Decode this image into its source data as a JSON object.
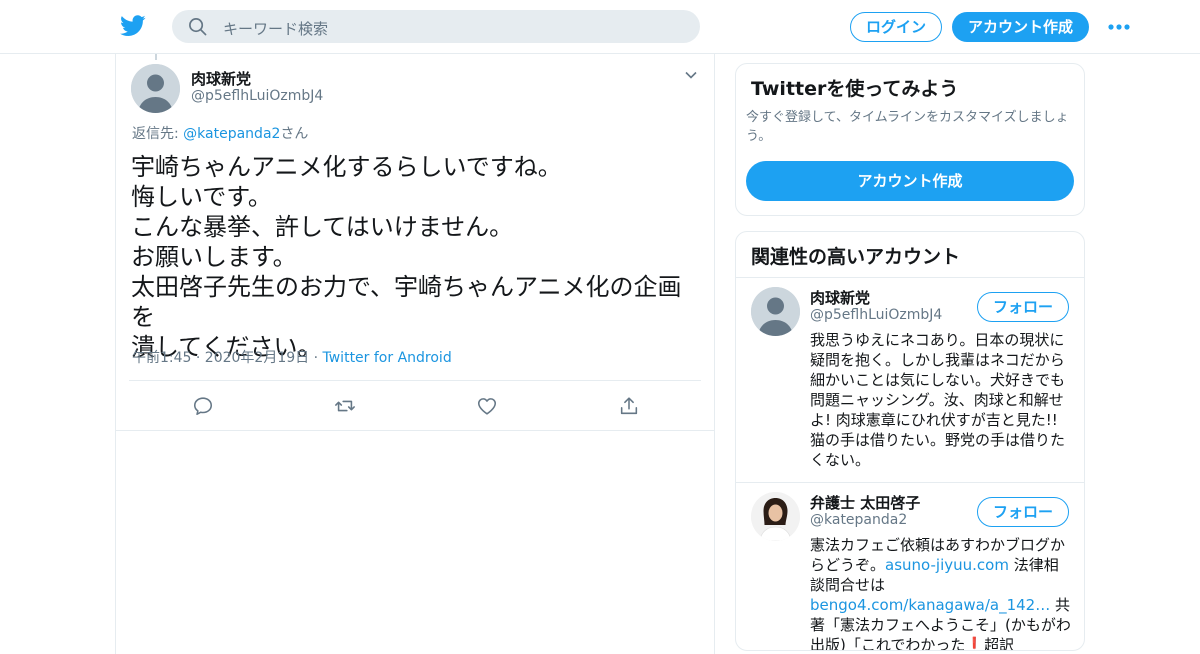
{
  "header": {
    "search_placeholder": "キーワード検索",
    "login_label": "ログイン",
    "signup_label": "アカウント作成",
    "logo_icon": "twitter-bird-icon",
    "more_icon": "more-dots-icon"
  },
  "tweet": {
    "name": "肉球新党",
    "handle": "@p5eflhLuiOzmbJ4",
    "reply_prefix": "返信先: ",
    "reply_handle": "@katepanda2",
    "reply_suffix": "さん",
    "lines": [
      "宇崎ちゃんアニメ化するらしいですね。",
      "悔しいです。",
      "こんな暴挙、許してはいけません。",
      "お願いします。",
      "太田啓子先生のお力で、宇崎ちゃんアニメ化の企画を",
      "潰してください。"
    ],
    "timestamp": "午前1:45 · 2020年2月19日 · ",
    "client": "Twitter for Android",
    "actions": [
      "reply-icon",
      "retweet-icon",
      "like-icon",
      "share-icon"
    ]
  },
  "signup_card": {
    "title": "Twitterを使ってみよう",
    "desc": "今すぐ登録して、タイムラインをカスタマイズしましょう。",
    "button": "アカウント作成"
  },
  "related": {
    "title": "関連性の高いアカウント",
    "follow_label": "フォロー",
    "accounts": [
      {
        "name": "肉球新党",
        "handle": "@p5eflhLuiOzmbJ4",
        "bio": "我思うゆえにネコあり。日本の現状に疑問を抱く。しかし我輩はネコだから細かいことは気にしない。犬好きでも問題ニャッシング。汝、肉球と和解せよ! 肉球憲章にひれ伏すが吉と見た!! 猫の手は借りたい。野党の手は借りたくない。"
      },
      {
        "name": "弁護士 太田啓子",
        "handle": "@katepanda2",
        "bio_a": "憲法カフェご依頼はあすわかブログからどうぞ。",
        "bio_link1": "asuno-jiyuu.com",
        "bio_b": " 法律相談問合せは",
        "bio_link2": "bengo4.com/kanagawa/a_142…",
        "bio_c": " 共著「憲法カフェへようこそ」(かもがわ出版)「これでわかった❗超訳"
      }
    ]
  },
  "colors": {
    "accent": "#1da1f2",
    "link": "#1b95e0",
    "muted": "#657786",
    "border": "#e6ecf0"
  }
}
